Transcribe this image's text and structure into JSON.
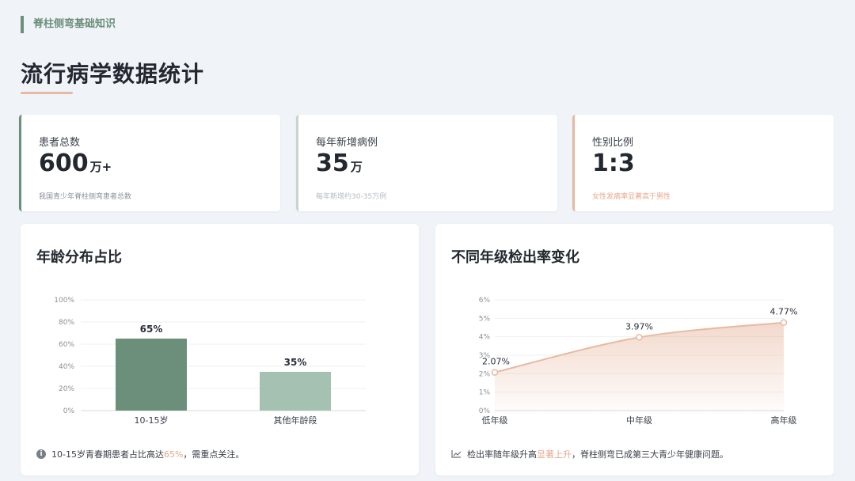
{
  "header": {
    "section_tag": "脊柱侧弯基础知识",
    "title": "流行病学数据统计"
  },
  "stats": [
    {
      "label": "患者总数",
      "value": "600",
      "unit": "万+",
      "note": "我国青少年脊柱侧弯患者总数"
    },
    {
      "label": "每年新增病例",
      "value": "35",
      "unit": "万",
      "note": "每年新增约30-35万例"
    },
    {
      "label": "性别比例",
      "value": "1:3",
      "unit": "",
      "note": "女性发病率显著高于男性"
    }
  ],
  "colors": {
    "bar_primary": "#6b8f7b",
    "bar_secondary": "#a5c1b2",
    "line": "#e8b9a2",
    "accent": "#e6a78a"
  },
  "age_chart": {
    "title": "年龄分布占比",
    "footnote_pre": "10-15岁青春期患者占比高达",
    "footnote_hl": "65%",
    "footnote_post": "，需重点关注。"
  },
  "grade_chart": {
    "title": "不同年级检出率变化",
    "footnote_pre": "检出率随年级升高",
    "footnote_hl": "显著上升",
    "footnote_post": "，脊柱侧弯已成第三大青少年健康问题。"
  },
  "chart_data": [
    {
      "type": "bar",
      "title": "年龄分布占比",
      "categories": [
        "10-15岁",
        "其他年龄段"
      ],
      "values": [
        65,
        35
      ],
      "data_labels": [
        "65%",
        "35%"
      ],
      "ylim": [
        0,
        100
      ],
      "yticks": [
        "0%",
        "20%",
        "40%",
        "60%",
        "80%",
        "100%"
      ],
      "grid": true
    },
    {
      "type": "area",
      "title": "不同年级检出率变化",
      "categories": [
        "低年级",
        "中年级",
        "高年级"
      ],
      "values": [
        2.07,
        3.97,
        4.77
      ],
      "data_labels": [
        "2.07%",
        "3.97%",
        "4.77%"
      ],
      "ylim": [
        0,
        6
      ],
      "yticks": [
        "0%",
        "1%",
        "2%",
        "3%",
        "4%",
        "5%",
        "6%"
      ],
      "grid": true
    }
  ]
}
